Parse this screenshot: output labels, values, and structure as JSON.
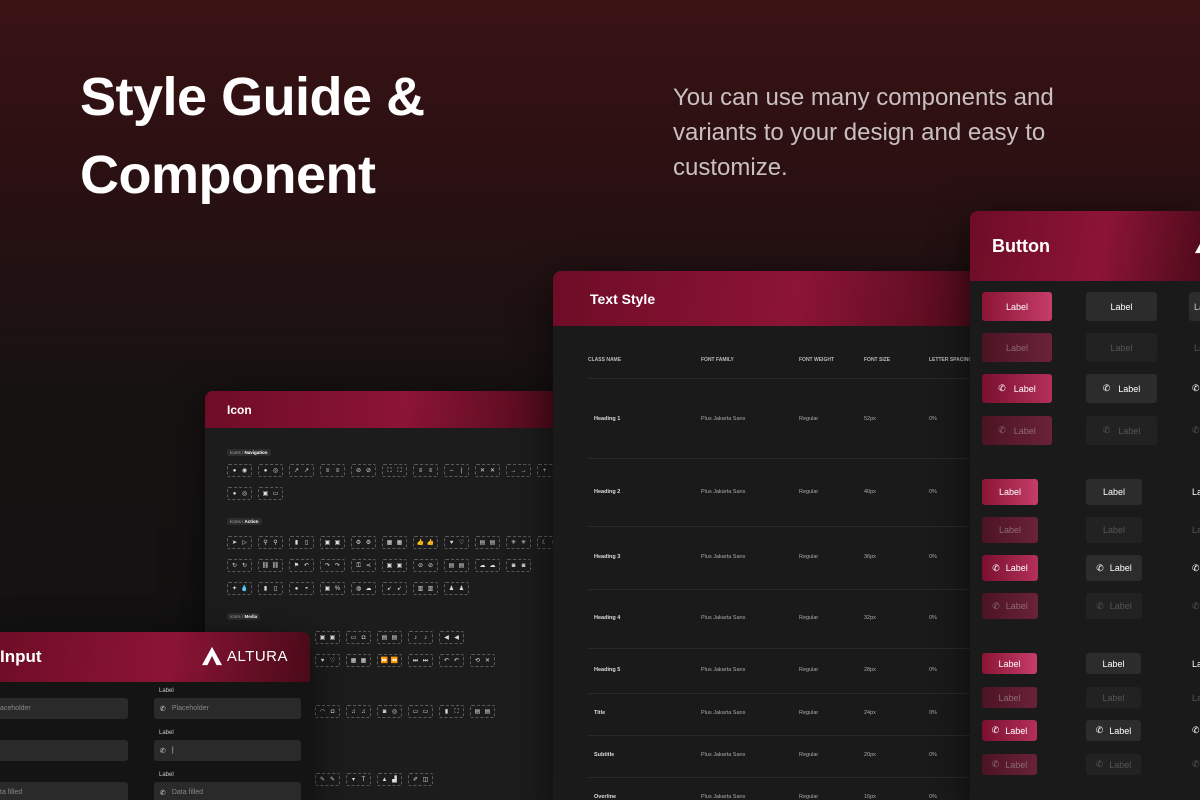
{
  "hero": {
    "title": "Style Guide & Component",
    "description": "You can use many components and variants to your design and easy to customize."
  },
  "icon_panel": {
    "title": "Icon",
    "sections": [
      {
        "prefix": "Icons / ",
        "name": "Navigation"
      },
      {
        "prefix": "Icons / ",
        "name": "Action"
      },
      {
        "prefix": "Icons / ",
        "name": "Media"
      }
    ]
  },
  "text_style": {
    "title": "Text Style",
    "columns": [
      "CLASS NAME",
      "FONT FAMILY",
      "FONT WEIGHT",
      "FONT SIZE",
      "LETTER SPACING"
    ],
    "rows": [
      {
        "name": "Heading 1",
        "family": "Plus Jakarta Sans",
        "weight": "Regular",
        "size": "52px",
        "spacing": "0%"
      },
      {
        "name": "Heading 2",
        "family": "Plus Jakarta Sans",
        "weight": "Regular",
        "size": "40px",
        "spacing": "0%"
      },
      {
        "name": "Heading 3",
        "family": "Plus Jakarta Sans",
        "weight": "Regular",
        "size": "36px",
        "spacing": "0%"
      },
      {
        "name": "Heading 4",
        "family": "Plus Jakarta Sans",
        "weight": "Regular",
        "size": "32px",
        "spacing": "0%"
      },
      {
        "name": "Heading 5",
        "family": "Plus Jakarta Sans",
        "weight": "Regular",
        "size": "28px",
        "spacing": "0%"
      },
      {
        "name": "Title",
        "family": "Plus Jakarta Sans",
        "weight": "Regular",
        "size": "24px",
        "spacing": "0%"
      },
      {
        "name": "Subtitle",
        "family": "Plus Jakarta Sans",
        "weight": "Regular",
        "size": "20px",
        "spacing": "0%"
      },
      {
        "name": "Overline",
        "family": "Plus Jakarta Sans",
        "weight": "Regular",
        "size": "16px",
        "spacing": "0%"
      }
    ]
  },
  "button_panel": {
    "title": "Button",
    "button_label": "Label",
    "partial_label": "La"
  },
  "input_panel": {
    "title": "Input",
    "brand": "ALTURA",
    "field_label": "Label",
    "placeholder": "Placeholder",
    "placeholder_partial": "aceholder",
    "filled": "Data filled",
    "filled_partial": "ta filled"
  },
  "colors": {
    "accent": "#8c1436",
    "accent_light": "#c63d68",
    "panel_bg": "#1c1c1c",
    "page_bg_top": "#3a1214"
  }
}
